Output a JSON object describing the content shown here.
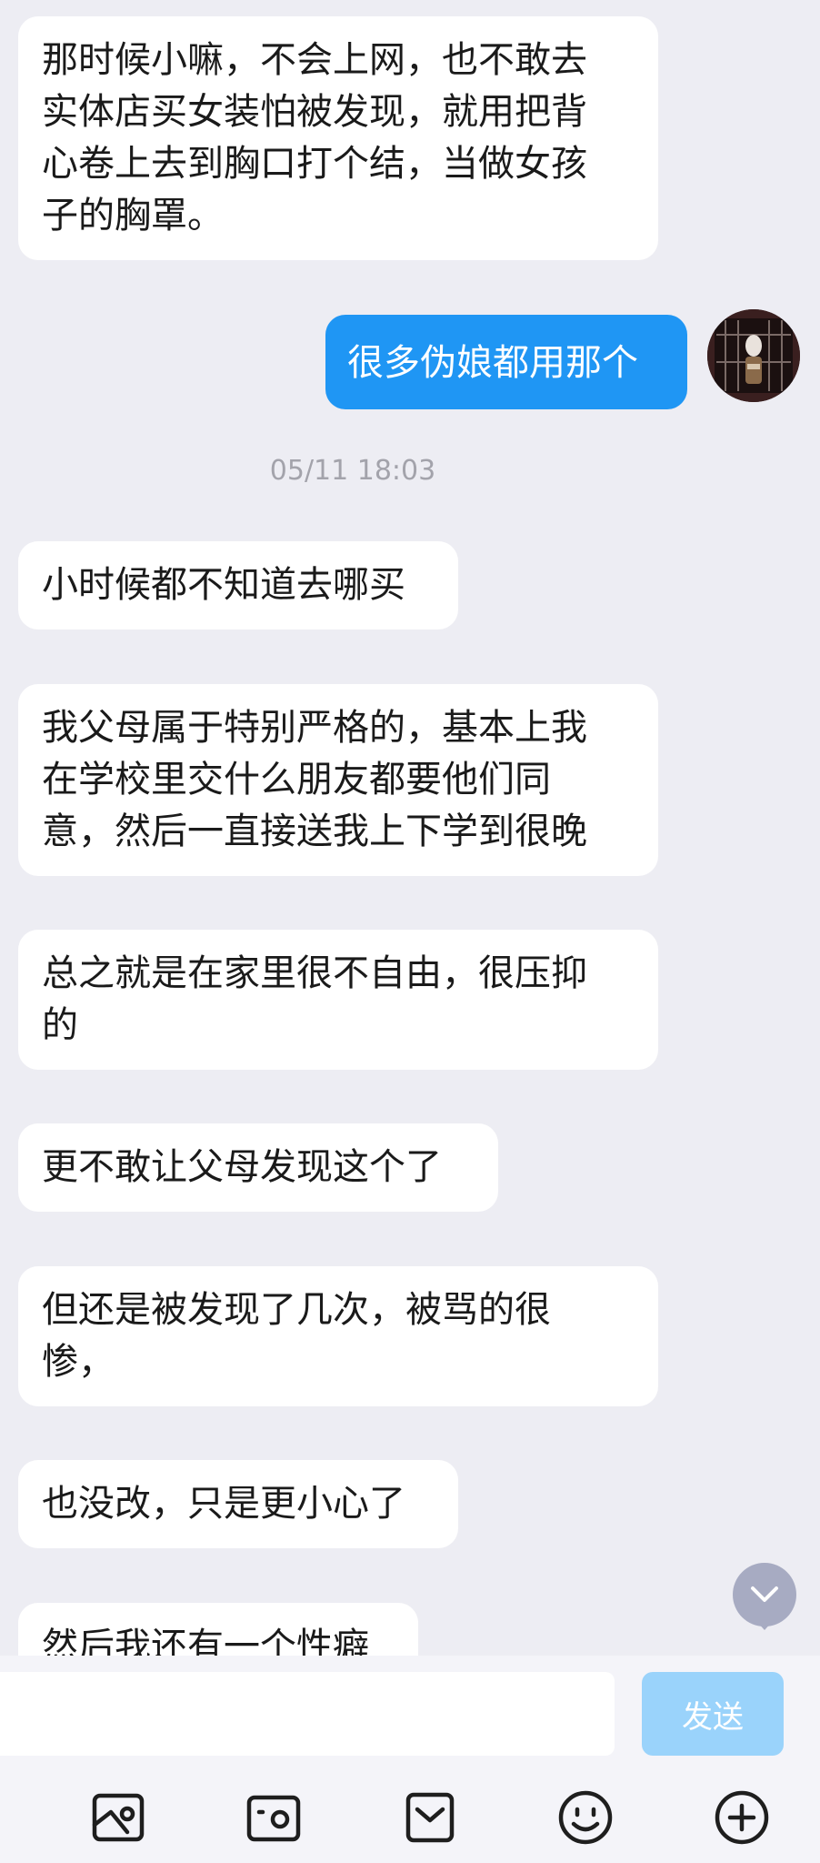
{
  "messages": [
    {
      "side": "left",
      "text": "那时候小嘛，不会上网，也不敢去\n实体店买女装怕被发现，就用把背\n心卷上去到胸口打个结，当做女孩\n子的胸罩。"
    },
    {
      "side": "right",
      "text": "很多伪娘都用那个"
    },
    {
      "side": "left",
      "text": "小时候都不知道去哪买"
    },
    {
      "side": "left",
      "text": "我父母属于特别严格的，基本上我\n在学校里交什么朋友都要他们同\n意，然后一直接送我上下学到很晚"
    },
    {
      "side": "left",
      "text": "总之就是在家里很不自由，很压抑\n的"
    },
    {
      "side": "left",
      "text": "更不敢让父母发现这个了"
    },
    {
      "side": "left",
      "text": "但还是被发现了几次，被骂的很\n惨，"
    },
    {
      "side": "left",
      "text": "也没改，只是更小心了"
    },
    {
      "side": "left",
      "text": "然后我还有一个性癖"
    }
  ],
  "timestamp": "05/11 18:03",
  "composer": {
    "input_value": "",
    "send_label": "发送"
  },
  "toolbar_icons": [
    "image-icon",
    "camera-icon",
    "folder-icon",
    "emoji-icon",
    "plus-icon"
  ],
  "colors": {
    "background": "#ededf3",
    "incoming_bubble": "#ffffff",
    "outgoing_bubble": "#1f96f4",
    "send_button": "#9ad3fb",
    "scroll_button": "#a7abc2"
  }
}
